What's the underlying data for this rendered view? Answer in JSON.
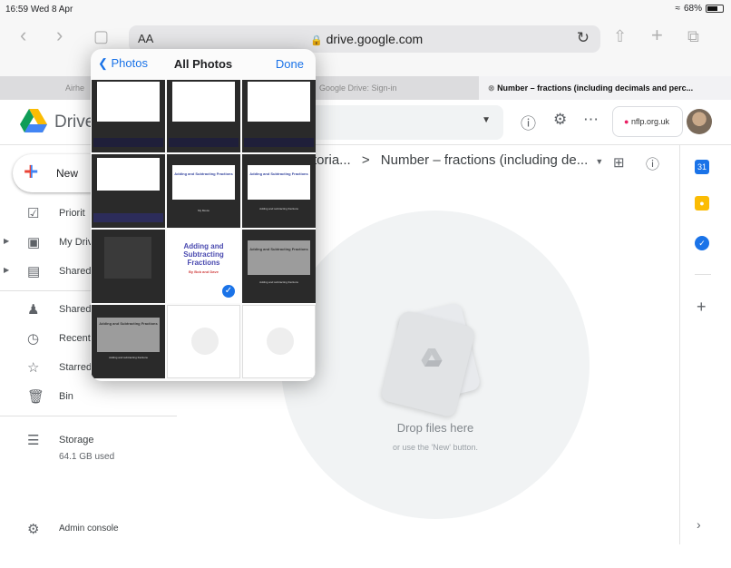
{
  "status_bar": {
    "time": "16:59",
    "date": "Wed 8 Apr",
    "battery": "68%"
  },
  "safari": {
    "text_size_label": "AA",
    "url": "drive.google.com"
  },
  "tabs": [
    {
      "label": "Airhe",
      "active": false
    },
    {
      "label": "Google Drive: Sign-in",
      "active": false
    },
    {
      "label": "Number – fractions (including decimals and perc...",
      "active": true
    }
  ],
  "drive": {
    "brand": "Drive",
    "account_domain": "nflp.org.uk",
    "new_label": "New",
    "sidebar": [
      {
        "label": "Priorit",
        "icon": "checkbox-icon"
      },
      {
        "label": "My Drive",
        "icon": "drive-icon"
      },
      {
        "label": "Shared d",
        "icon": "shared-drives-icon"
      },
      {
        "label": "Shared",
        "icon": "people-icon"
      },
      {
        "label": "Recent",
        "icon": "clock-icon"
      },
      {
        "label": "Starred",
        "icon": "star-icon"
      },
      {
        "label": "Bin",
        "icon": "bin-icon"
      }
    ],
    "storage": {
      "label": "Storage",
      "used": "64.1 GB used"
    },
    "admin_label": "Admin console",
    "breadcrumb": {
      "parent": "toria...",
      "separator": ">",
      "current": "Number – fractions (including de..."
    },
    "empty_state": {
      "title": "Drop files here",
      "subtitle": "or use the 'New' button."
    }
  },
  "photos_popover": {
    "back_label": "Photos",
    "title": "All Photos",
    "done_label": "Done",
    "thumb_text": {
      "adding_title": "Adding and Subtracting Fractions",
      "adding_sub": "Adding and subtracting fractions",
      "large_title": "Adding and Subtracting Fractions",
      "large_sub": "By Bob and Dave",
      "my_movie": "My Movie"
    }
  },
  "colors": {
    "accent": "#1a73e8",
    "calendar": "#1a73e8",
    "keep": "#fbbc04",
    "tasks": "#1a73e8"
  }
}
